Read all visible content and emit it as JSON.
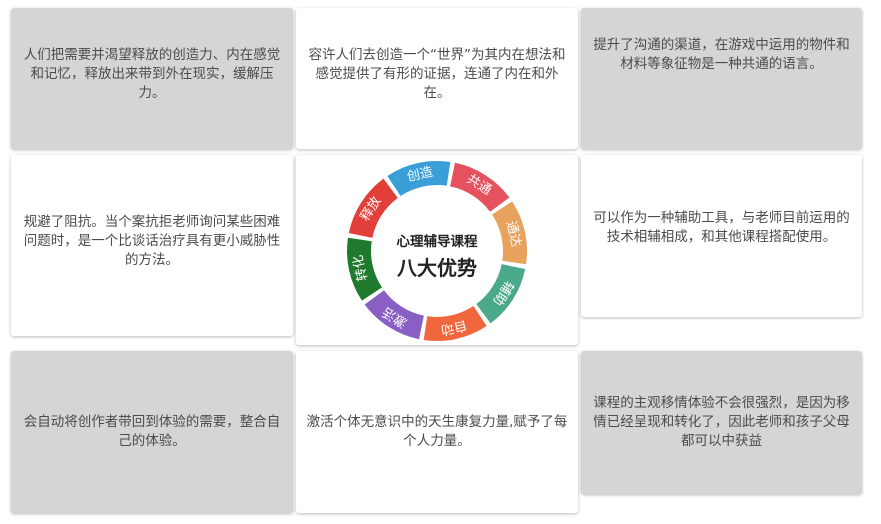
{
  "cards": {
    "top_left": "人们把需要并渴望释放的创造力、内在感觉和记忆，释放出来带到外在现实，缓解压力。",
    "top_middle": "容许人们去创造一个“世界”为其内在想法和感觉提供了有形的证据，连通了内在和外在。",
    "top_right": "提升了沟通的渠道，在游戏中运用的物件和材料等象征物是一种共通的语言。",
    "mid_left": "规避了阻抗。当个案抗拒老师询问某些困难问题时，是一个比谈话治疗具有更小威胁性的方法。",
    "mid_right": "可以作为一种辅助工具，与老师目前运用的技术相辅相成，和其他课程搭配使用。",
    "bottom_left": "会自动将创作者带回到体验的需要，整合自己的体验。",
    "bottom_middle": "激活个体无意识中的天生康复力量,赋予了每个人力量。",
    "bottom_right": "课程的主观移情体验不会很强烈，是因为移情已经呈现和转化了，因此老师和孩子父母都可以中获益"
  },
  "wheel": {
    "title_small": "心理辅导课程",
    "title_big": "八大优势",
    "segments": [
      {
        "label": "共通",
        "color": "#e6515f"
      },
      {
        "label": "通达",
        "color": "#e7a25e"
      },
      {
        "label": "辅助",
        "color": "#4aa98b"
      },
      {
        "label": "自动",
        "color": "#f0673e"
      },
      {
        "label": "激活",
        "color": "#8a5fc4"
      },
      {
        "label": "转化",
        "color": "#1f7a2e"
      },
      {
        "label": "释放",
        "color": "#e33f3a"
      },
      {
        "label": "创造",
        "color": "#3a9fd8"
      }
    ]
  },
  "colors": {
    "gray_card": "#d5d5d5",
    "text": "#4b4b4b"
  }
}
